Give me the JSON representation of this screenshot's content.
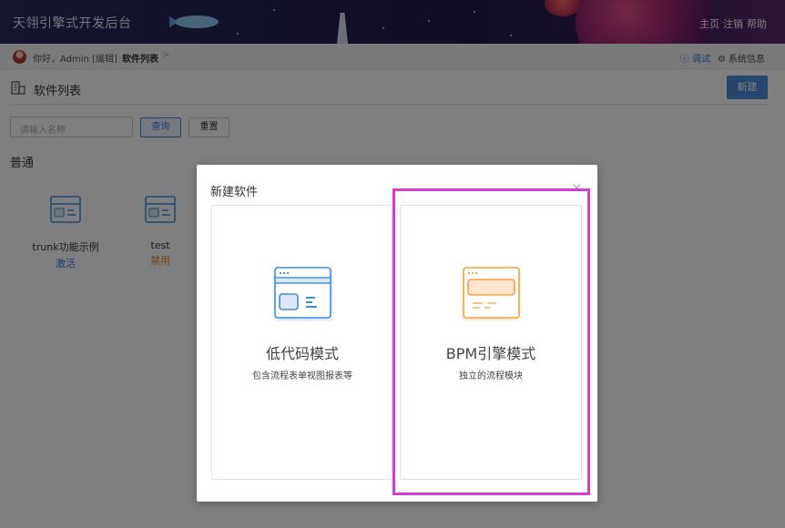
{
  "header": {
    "app_title": "天翎引擎式开发后台",
    "nav": [
      "主页",
      "注销",
      "帮助"
    ]
  },
  "breadcrumb": {
    "greeting": "你好，Admin [编辑]",
    "current": "软件列表",
    "separator": ">",
    "right_links": [
      {
        "label": "ⓘ 调试",
        "icon": "info-icon"
      },
      {
        "label": "⚙ 系统信息",
        "icon": "gear-icon"
      }
    ]
  },
  "page": {
    "title": "软件列表",
    "new_button": "新建"
  },
  "search": {
    "placeholder": "请输入名称",
    "query_button": "查询",
    "reset_button": "重置"
  },
  "section": {
    "title": "普通",
    "apps": [
      {
        "name": "trunk功能示例",
        "status": "激活",
        "status_color": "#3a7bd5"
      },
      {
        "name": "test",
        "status": "禁用",
        "status_color": "#e08a2a"
      }
    ]
  },
  "modal": {
    "title": "新建软件",
    "close": "×",
    "options": [
      {
        "title": "低代码模式",
        "desc": "包含流程表单视图报表等",
        "accent": "#3a8ee6"
      },
      {
        "title": "BPM引擎模式",
        "desc": "独立的流程模块",
        "accent": "#f5a23a"
      }
    ]
  },
  "colors": {
    "primary": "#4a8fdc",
    "highlight": "#d63bd6"
  }
}
